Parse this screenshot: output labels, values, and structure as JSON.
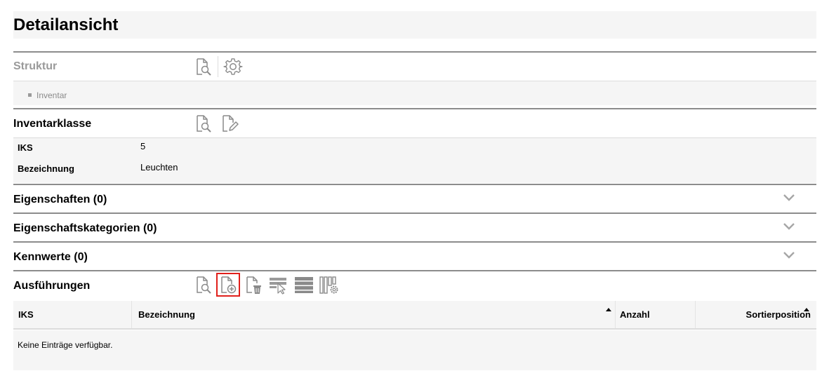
{
  "page": {
    "title": "Detailansicht"
  },
  "struktur": {
    "title": "Struktur",
    "tree": [
      {
        "label": "Inventar"
      }
    ]
  },
  "inventarklasse": {
    "title": "Inventarklasse",
    "fields": [
      {
        "label": "IKS",
        "value": "5"
      },
      {
        "label": "Bezeichnung",
        "value": "Leuchten"
      }
    ]
  },
  "collapsed_sections": [
    {
      "title": "Eigenschaften (0)"
    },
    {
      "title": "Eigenschaftskategorien (0)"
    },
    {
      "title": "Kennwerte (0)"
    }
  ],
  "ausfuehrungen": {
    "title": "Ausführungen",
    "columns": [
      {
        "label": "IKS"
      },
      {
        "label": "Bezeichnung"
      },
      {
        "label": "Anzahl"
      },
      {
        "label": "Sortierposition"
      }
    ],
    "empty_message": "Keine Einträge verfügbar."
  },
  "icons": {
    "view": "document-search-icon",
    "settings": "gear-icon",
    "edit": "document-edit-icon",
    "add": "document-add-icon",
    "delete": "document-delete-icon",
    "select": "row-select-icon",
    "rows": "table-rows-icon",
    "columns": "column-settings-icon",
    "expand": "chevron-down-icon"
  },
  "colors": {
    "highlight": "#e0201b",
    "panel": "#f5f5f5",
    "rule": "#8c8c8c",
    "icon": "#8a8a8a"
  }
}
